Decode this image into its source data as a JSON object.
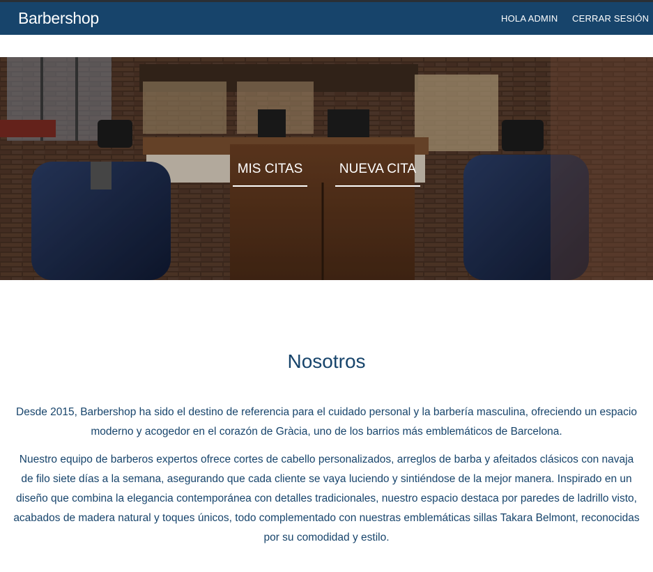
{
  "navbar": {
    "brand": "Barbershop",
    "links": [
      {
        "label": "HOLA ADMIN"
      },
      {
        "label": "CERRAR SESIÓN"
      }
    ]
  },
  "hero": {
    "buttons": [
      {
        "label": "MIS CITAS"
      },
      {
        "label": "NUEVA CITA"
      }
    ]
  },
  "about": {
    "title": "Nosotros",
    "paragraphs": [
      "Desde 2015, Barbershop ha sido el destino de referencia para el cuidado personal y la barbería masculina, ofreciendo un espacio moderno y acogedor en el corazón de Gràcia, uno de los barrios más emblemáticos de Barcelona.",
      "Nuestro equipo de barberos expertos ofrece cortes de cabello personalizados, arreglos de barba y afeitados clásicos con navaja de filo siete días a la semana, asegurando que cada cliente se vaya luciendo y sintiéndose de la mejor manera. Inspirado en un diseño que combina la elegancia contemporánea con detalles tradicionales, nuestro espacio destaca por paredes de ladrillo visto, acabados de madera natural y toques únicos, todo complementado con nuestras emblemáticas sillas Takara Belmont, reconocidas por su comodidad y estilo."
    ]
  },
  "colors": {
    "navbar_bg": "#17446b",
    "text_primary": "#17446b",
    "hero_button_text": "#ffffff"
  }
}
